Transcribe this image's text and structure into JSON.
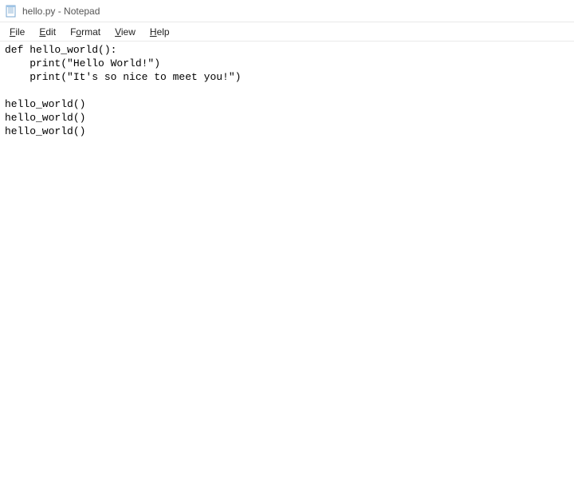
{
  "titlebar": {
    "title": "hello.py - Notepad"
  },
  "menubar": {
    "file": "File",
    "edit": "Edit",
    "format": "Format",
    "view": "View",
    "help": "Help"
  },
  "editor": {
    "content": "def hello_world():\n    print(\"Hello World!\")\n    print(\"It's so nice to meet you!\")\n\nhello_world()\nhello_world()\nhello_world()"
  }
}
